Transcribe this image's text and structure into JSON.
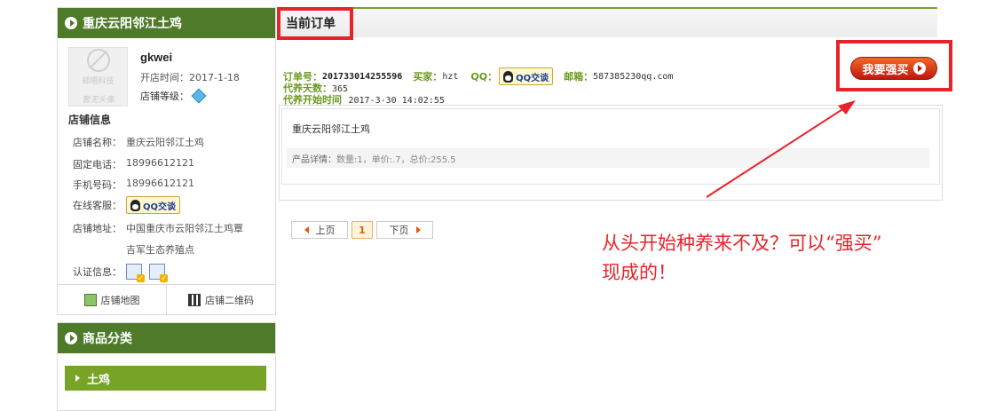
{
  "shop": {
    "name": "重庆云阳邻江土鸡",
    "avatar_line1": "邮唔科技",
    "avatar_line2": "暂无头像",
    "username": "gkwei",
    "open_time": "开店时间：2017-1-18",
    "level_label": "店铺等级：",
    "info_title": "店铺信息",
    "fields": [
      {
        "k": "店铺名称：",
        "v": "重庆云阳邻江土鸡"
      },
      {
        "k": "固定电话：",
        "v": "18996612121"
      },
      {
        "k": "手机号码：",
        "v": "18996612121"
      },
      {
        "k": "在线客服：",
        "v": ""
      },
      {
        "k": "店铺地址：",
        "v": "中国重庆市云阳邻江土鸡覃"
      },
      {
        "k": "",
        "v": "吉军生态养殖点"
      },
      {
        "k": "认证信息：",
        "v": ""
      }
    ],
    "qq_label": "QQ交谈",
    "tab_map": "店铺地图",
    "tab_qr": "店铺二维码"
  },
  "categories": {
    "title": "商品分类",
    "items": [
      "土鸡"
    ]
  },
  "orders": {
    "title": "当前订单",
    "order_no_label": "订单号：",
    "order_no": "201733014255596",
    "buyer_label": "买家：",
    "buyer": "hzt",
    "qq_label": "QQ：",
    "qq_btn": "QQ交谈",
    "email_label": "邮箱：",
    "email": "587385230qq.com",
    "days_label": "代养天数：",
    "days": "365",
    "start_label": "代养开始时间",
    "start": "2017-3-30 14:02:55",
    "buy_button": "我要强买",
    "product_name": "重庆云阳邻江土鸡",
    "product_detail_label": "产品详情：",
    "product_detail": "数量:1，单价:.7，总价:255.5"
  },
  "pager": {
    "prev": "上页",
    "current": "1",
    "next": "下页"
  },
  "annotation": {
    "line1": "从头开始种养来不及？可以“强买”",
    "line2": "现成的！"
  },
  "colors": {
    "green_dark": "#4e7a2a",
    "green_light": "#77a327",
    "highlight_red": "#e8232a"
  }
}
